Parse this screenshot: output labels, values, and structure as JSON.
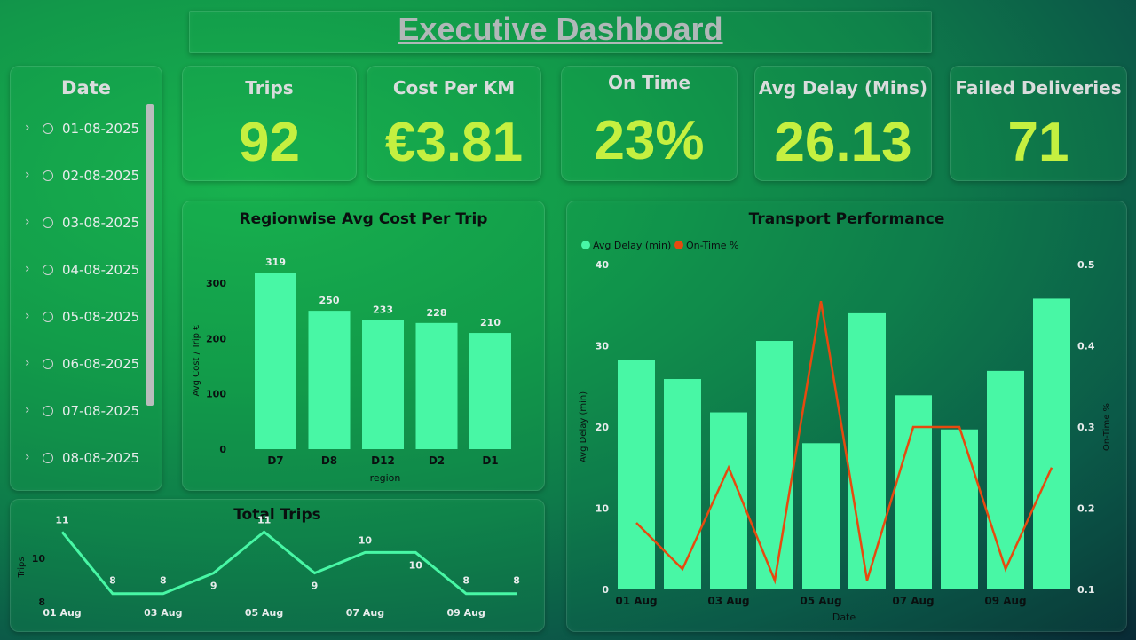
{
  "header": {
    "title": "Executive Dashboard"
  },
  "slicer": {
    "title": "Date",
    "items": [
      "01-08-2025",
      "02-08-2025",
      "03-08-2025",
      "04-08-2025",
      "05-08-2025",
      "06-08-2025",
      "07-08-2025",
      "08-08-2025"
    ]
  },
  "kpis": [
    {
      "label": "Trips",
      "value": "92"
    },
    {
      "label": "Cost Per KM",
      "value": "€3.81"
    },
    {
      "label": "On Time",
      "value": "23%"
    },
    {
      "label": "Avg Delay (Mins)",
      "value": "26.13"
    },
    {
      "label": "Failed Deliveries",
      "value": "71"
    }
  ],
  "colors": {
    "bar": "#48f7a5",
    "line_ontime": "#e64a0f",
    "kpi_value": "#c5f040",
    "trips_line": "#48f7a5"
  },
  "chart_data": [
    {
      "type": "bar",
      "title": "Regionwise Avg Cost Per Trip",
      "xlabel": "region",
      "ylabel": "Avg Cost / Trip €",
      "categories": [
        "D7",
        "D8",
        "D12",
        "D2",
        "D1"
      ],
      "values": [
        319,
        250,
        233,
        228,
        210
      ],
      "yticks": [
        "0",
        "100",
        "200",
        "300"
      ],
      "ylim": [
        0,
        340
      ],
      "grid": false
    },
    {
      "type": "bar+line",
      "title": "Transport Performance",
      "xlabel": "Date",
      "ylabel": "Avg Delay (min)",
      "y2label": "On-Time %",
      "legend": [
        "Avg Delay (min)",
        "On-Time %"
      ],
      "legend_position": "top-left",
      "x_tick_labels": [
        "01 Aug",
        "03 Aug",
        "05 Aug",
        "07 Aug",
        "09 Aug"
      ],
      "yticks": [
        "0",
        "10",
        "20",
        "30",
        "40"
      ],
      "y2ticks": [
        "0.1",
        "0.2",
        "0.3",
        "0.4",
        "0.5"
      ],
      "ylim": [
        0,
        40
      ],
      "y2lim": [
        0.1,
        0.5
      ],
      "series": [
        {
          "name": "Avg Delay (min)",
          "kind": "bar",
          "values": [
            28.2,
            25.9,
            21.8,
            30.6,
            18.0,
            34.0,
            23.9,
            19.7,
            26.9,
            35.8
          ]
        },
        {
          "name": "On-Time %",
          "kind": "line",
          "values": [
            0.182,
            0.125,
            0.25,
            0.111,
            0.455,
            0.111,
            0.3,
            0.3,
            0.125,
            0.25
          ]
        }
      ]
    },
    {
      "type": "line",
      "title": "Total Trips",
      "ylabel": "Trips",
      "x_tick_labels": [
        "01 Aug",
        "03 Aug",
        "05 Aug",
        "07 Aug",
        "09 Aug"
      ],
      "yticks": [
        "8",
        "10"
      ],
      "ylim": [
        7.6,
        11.4
      ],
      "values": [
        11,
        8,
        8,
        9,
        11,
        9,
        10,
        10,
        8,
        8
      ],
      "grid": false
    }
  ]
}
